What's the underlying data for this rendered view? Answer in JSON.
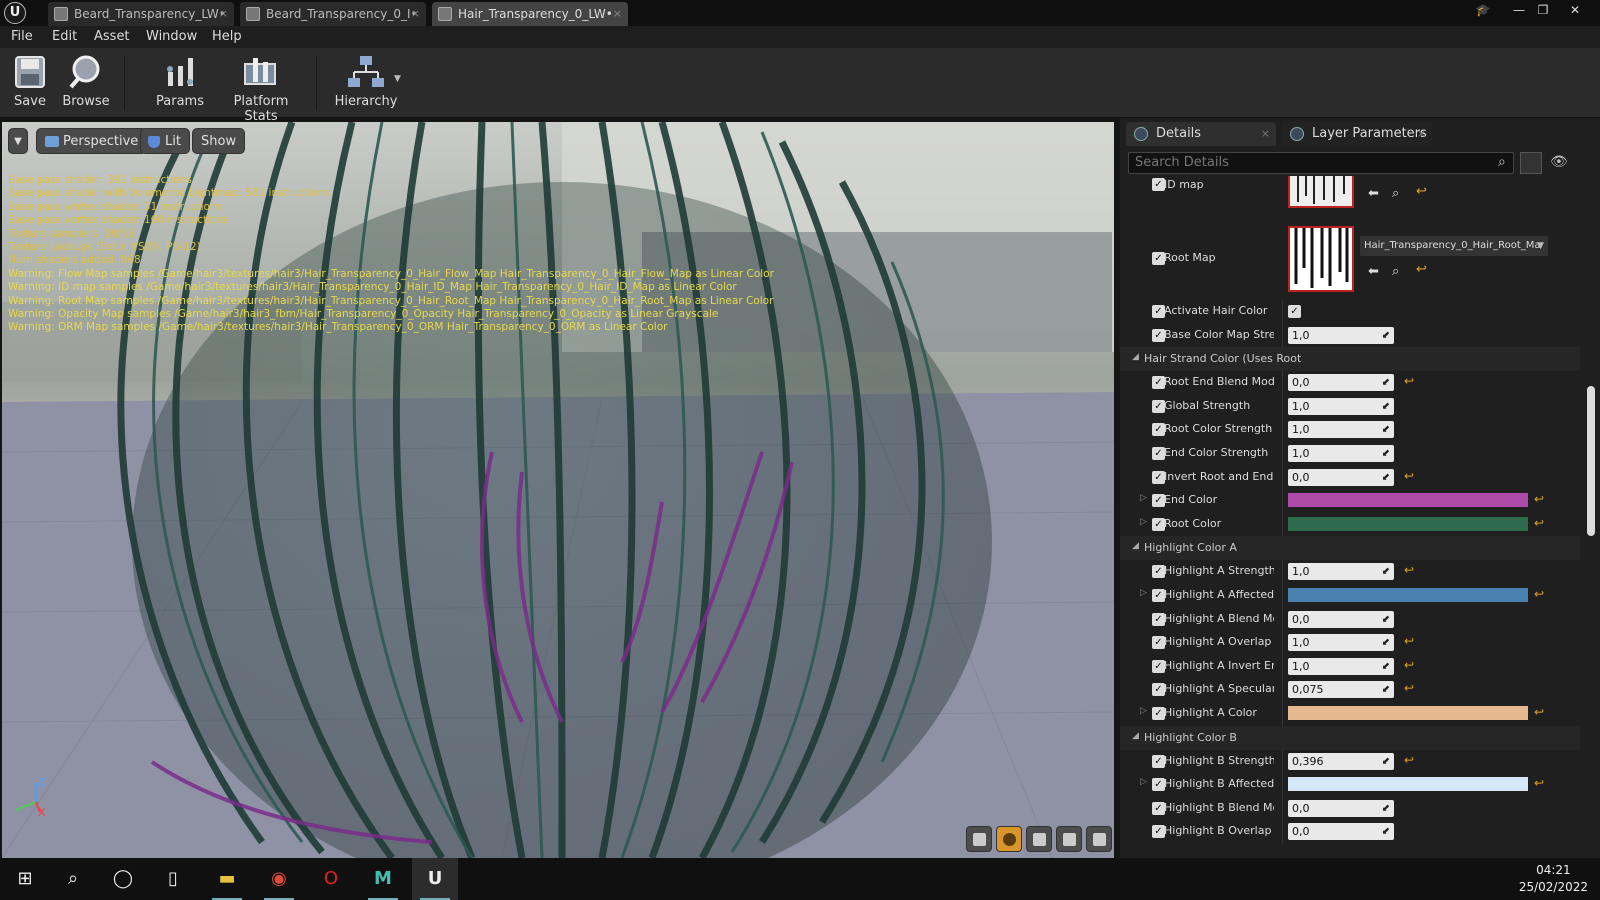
{
  "tabs": [
    {
      "label": "Beard_Transparency_LW•",
      "active": false
    },
    {
      "label": "Beard_Transparency_0_I•",
      "active": false
    },
    {
      "label": "Hair_Transparency_0_LW•",
      "active": true
    }
  ],
  "menu": [
    "File",
    "Edit",
    "Asset",
    "Window",
    "Help"
  ],
  "toolbar": {
    "save": "Save",
    "browse": "Browse",
    "params": "Params",
    "platform_stats": "Platform Stats",
    "hierarchy": "Hierarchy"
  },
  "viewport": {
    "perspective": "Perspective",
    "lit": "Lit",
    "show": "Show",
    "stats": [
      {
        "text": "Base pass shader: 391 instructions",
        "warn": false
      },
      {
        "text": "Base pass shader with Volumetric Lightmap: 581 instructions",
        "warn": false
      },
      {
        "text": "Base pass vertex shader: 51 instructions",
        "warn": false
      },
      {
        "text": "Base pass vertex shader: 160 instructions",
        "warn": false
      },
      {
        "text": "Texture samplers: 10/16",
        "warn": false
      },
      {
        "text": "Texture Lookups (Est.): VS(0), PS(12)",
        "warn": false
      },
      {
        "text": "Num shaders added: 868",
        "warn": false
      },
      {
        "text": "Warning: Flow Map samples /Game/hair3/textures/hair3/Hair_Transparency_0_Hair_Flow_Map Hair_Transparency_0_Hair_Flow_Map as Linear Color",
        "warn": true
      },
      {
        "text": "Warning: ID map samples /Game/hair3/textures/hair3/Hair_Transparency_0_Hair_ID_Map Hair_Transparency_0_Hair_ID_Map as Linear Color",
        "warn": true
      },
      {
        "text": "Warning: Root Map samples /Game/hair3/textures/hair3/Hair_Transparency_0_Hair_Root_Map Hair_Transparency_0_Hair_Root_Map as Linear Color",
        "warn": true
      },
      {
        "text": "Warning: Opacity Map samples /Game/hair3/hair3_fbm/Hair_Transparency_0_Opacity Hair_Transparency_0_Opacity as Linear Grayscale",
        "warn": true
      },
      {
        "text": "Warning: ORM Map samples /Game/hair3/textures/hair3/Hair_Transparency_0_ORM Hair_Transparency_0_ORM as Linear Color",
        "warn": true
      }
    ],
    "axis": {
      "z": "Z",
      "x": "X"
    }
  },
  "panel": {
    "tab_details": "Details",
    "tab_layer": "Layer Parameters",
    "search_placeholder": "Search Details",
    "id_map": "ID map",
    "root_map": "Root Map",
    "root_map_asset": "Hair_Transparency_0_Hair_Root_Ma",
    "rows_top": [
      {
        "label": "Activate Hair Color",
        "type": "check"
      },
      {
        "label": "Base Color Map Streng",
        "type": "num",
        "value": "1,0",
        "reset": false
      }
    ],
    "group_strand": "Hair Strand Color (Uses Root",
    "rows_strand": [
      {
        "label": "Root End Blend Mode",
        "type": "num",
        "value": "0,0",
        "reset": true
      },
      {
        "label": "Global Strength",
        "type": "num",
        "value": "1,0",
        "reset": false
      },
      {
        "label": "Root Color Strength",
        "type": "num",
        "value": "1,0",
        "reset": false
      },
      {
        "label": "End Color Strength",
        "type": "num",
        "value": "1,0",
        "reset": false
      },
      {
        "label": "Invert Root and End Col",
        "type": "num",
        "value": "0,0",
        "reset": true
      },
      {
        "label": "End Color",
        "type": "color",
        "color": "#b04aa8"
      },
      {
        "label": "Root Color",
        "type": "color",
        "color": "#2f6a4c"
      }
    ],
    "group_a": "Highlight Color A",
    "rows_a": [
      {
        "label": "Highlight A Strength",
        "type": "num",
        "value": "1,0",
        "reset": true
      },
      {
        "label": "Highlight A Affected Ra",
        "type": "color",
        "color": "#4a80b0"
      },
      {
        "label": "Highlight A Blend Mode",
        "type": "num",
        "value": "0,0",
        "reset": false
      },
      {
        "label": "Highlight A Overlap End",
        "type": "num",
        "value": "1,0",
        "reset": true
      },
      {
        "label": "Highlight A Invert End to",
        "type": "num",
        "value": "1,0",
        "reset": true
      },
      {
        "label": "Highlight A Specular Sti",
        "type": "num",
        "value": "0,075",
        "reset": true
      },
      {
        "label": "Highlight A Color",
        "type": "color",
        "color": "#e6b890"
      }
    ],
    "group_b": "Highlight Color B",
    "rows_b": [
      {
        "label": "Highlight B Strength",
        "type": "num",
        "value": "0,396",
        "reset": true
      },
      {
        "label": "Highlight B Affected Ra",
        "type": "color",
        "color": "#d6e8f8"
      },
      {
        "label": "Highlight B Blend Mode",
        "type": "num",
        "value": "0,0",
        "reset": false
      },
      {
        "label": "Highlight B Overlap End",
        "type": "num",
        "value": "0,0",
        "reset": false
      }
    ]
  },
  "taskbar": {
    "time": "04:21",
    "date": "25/02/2022"
  }
}
